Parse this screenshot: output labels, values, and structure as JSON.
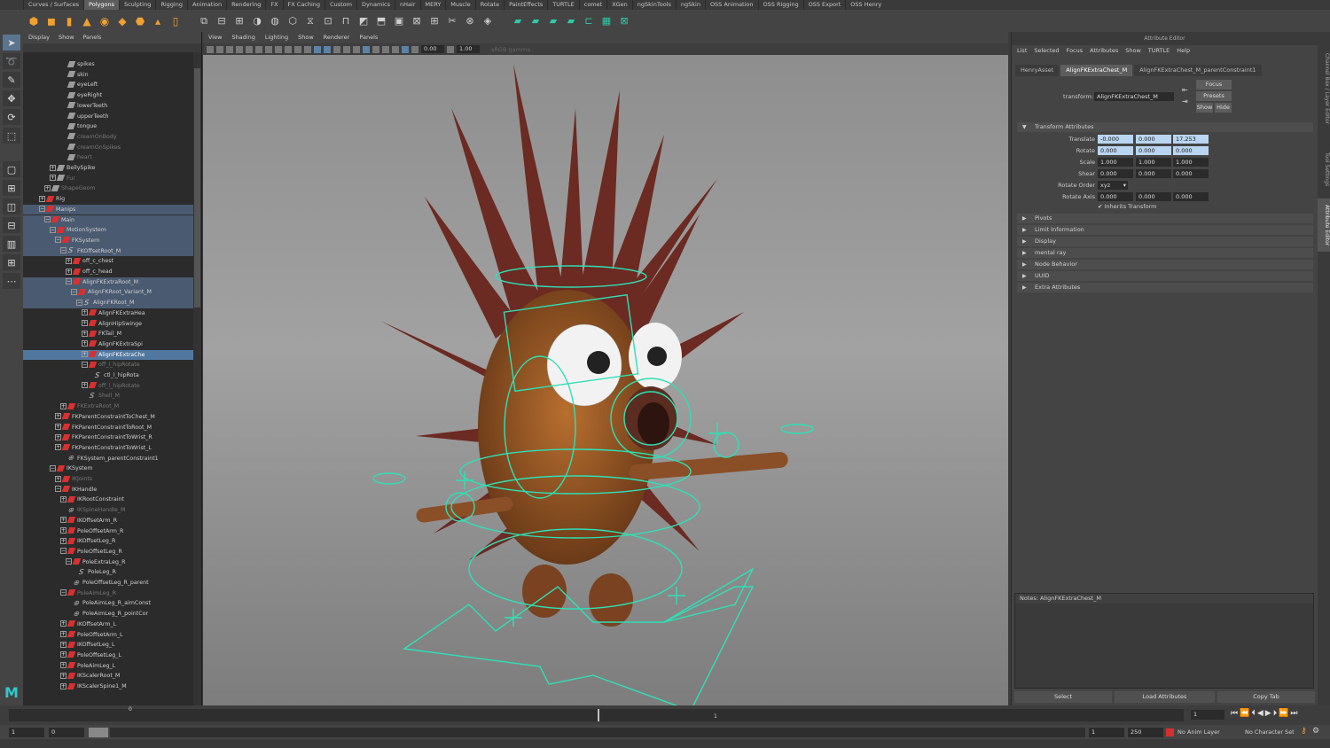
{
  "shelf_tabs": [
    "Curves / Surfaces",
    "Polygons",
    "Sculpting",
    "Rigging",
    "Animation",
    "Rendering",
    "FX",
    "FX Caching",
    "Custom",
    "Dynamics",
    "nHair",
    "MERY",
    "Muscle",
    "Rotate",
    "PaintEffects",
    "TURTLE",
    "comet",
    "XGen",
    "ngSkinTools",
    "ngSkin",
    "OSS Animation",
    "OSS Rigging",
    "OSS Export",
    "OSS Henry"
  ],
  "shelf_active": "Polygons",
  "outliner": {
    "menu": [
      "Display",
      "Show",
      "Panels"
    ],
    "rows": [
      {
        "label": "spikes",
        "indent": 7,
        "exp": "",
        "icon": "grp",
        "state": ""
      },
      {
        "label": "skin",
        "indent": 7,
        "exp": "",
        "icon": "grp",
        "state": ""
      },
      {
        "label": "eyeLeft",
        "indent": 7,
        "exp": "",
        "icon": "grp",
        "state": ""
      },
      {
        "label": "eyeRight",
        "indent": 7,
        "exp": "",
        "icon": "grp",
        "state": ""
      },
      {
        "label": "lowerTeeth",
        "indent": 7,
        "exp": "",
        "icon": "grp",
        "state": ""
      },
      {
        "label": "upperTeeth",
        "indent": 7,
        "exp": "",
        "icon": "grp",
        "state": ""
      },
      {
        "label": "tongue",
        "indent": 7,
        "exp": "",
        "icon": "grp",
        "state": ""
      },
      {
        "label": "creamOnBody",
        "indent": 7,
        "exp": "",
        "icon": "grp",
        "state": "dim"
      },
      {
        "label": "creamOnSpikes",
        "indent": 7,
        "exp": "",
        "icon": "grp",
        "state": "dim"
      },
      {
        "label": "heart",
        "indent": 7,
        "exp": "",
        "icon": "grp",
        "state": "dim"
      },
      {
        "label": "BellySpike",
        "indent": 5,
        "exp": "+",
        "icon": "grp",
        "state": ""
      },
      {
        "label": "Fur",
        "indent": 5,
        "exp": "+",
        "icon": "grp",
        "state": "dim"
      },
      {
        "label": "ShapeGeom",
        "indent": 4,
        "exp": "+",
        "icon": "grp",
        "state": "dim"
      },
      {
        "label": "Rig",
        "indent": 3,
        "exp": "+",
        "icon": "ctl",
        "state": ""
      },
      {
        "label": "Manips",
        "indent": 3,
        "exp": "−",
        "icon": "ctl",
        "state": "sel"
      },
      {
        "label": "Main",
        "indent": 4,
        "exp": "−",
        "icon": "img",
        "state": "sel"
      },
      {
        "label": "MotionSystem",
        "indent": 5,
        "exp": "−",
        "icon": "ctl",
        "state": "sel"
      },
      {
        "label": "FKSystem",
        "indent": 6,
        "exp": "−",
        "icon": "ctl",
        "state": "sel"
      },
      {
        "label": "FKOffsetRoot_M",
        "indent": 7,
        "exp": "−",
        "icon": "cv",
        "state": "sel"
      },
      {
        "label": "off_c_chest",
        "indent": 8,
        "exp": "+",
        "icon": "ctl",
        "state": ""
      },
      {
        "label": "off_c_head",
        "indent": 8,
        "exp": "+",
        "icon": "ctl",
        "state": ""
      },
      {
        "label": "AlignFKExtraRoot_M",
        "indent": 8,
        "exp": "−",
        "icon": "ctl",
        "state": "sel"
      },
      {
        "label": "AlignFKRoot_Variant_M",
        "indent": 9,
        "exp": "−",
        "icon": "ctl",
        "state": "sel"
      },
      {
        "label": "AlignFKRoot_M",
        "indent": 10,
        "exp": "−",
        "icon": "cv",
        "state": "sel"
      },
      {
        "label": "AlignFKExtraHea",
        "indent": 11,
        "exp": "+",
        "icon": "ctl",
        "state": ""
      },
      {
        "label": "AlignHipSwinge",
        "indent": 11,
        "exp": "+",
        "icon": "ctl",
        "state": ""
      },
      {
        "label": "FKTail_M",
        "indent": 11,
        "exp": "+",
        "icon": "ctl",
        "state": ""
      },
      {
        "label": "AlignFKExtraSpi",
        "indent": 11,
        "exp": "+",
        "icon": "ctl",
        "state": ""
      },
      {
        "label": "AlignFKExtraChe",
        "indent": 11,
        "exp": "+",
        "icon": "ctl",
        "state": "hi"
      },
      {
        "label": "off_l_hipRotate",
        "indent": 11,
        "exp": "−",
        "icon": "ctl",
        "state": "dim"
      },
      {
        "label": "ctl_l_hipRota",
        "indent": 12,
        "exp": "",
        "icon": "cv",
        "state": ""
      },
      {
        "label": "off_l_hipRotate",
        "indent": 11,
        "exp": "+",
        "icon": "ctl",
        "state": "dim"
      },
      {
        "label": "Shell_M",
        "indent": 11,
        "exp": "",
        "icon": "cv",
        "state": "dim"
      },
      {
        "label": "FKExtraRoot_M",
        "indent": 7,
        "exp": "+",
        "icon": "ctl",
        "state": "dim"
      },
      {
        "label": "FKParentConstraintToChest_M",
        "indent": 6,
        "exp": "+",
        "icon": "ctl",
        "state": ""
      },
      {
        "label": "FKParentConstraintToRoot_M",
        "indent": 6,
        "exp": "+",
        "icon": "ctl",
        "state": ""
      },
      {
        "label": "FKParentConstraintToWrist_R",
        "indent": 6,
        "exp": "+",
        "icon": "ctl",
        "state": ""
      },
      {
        "label": "FKParentConstraintToWrist_L",
        "indent": 6,
        "exp": "+",
        "icon": "ctl",
        "state": ""
      },
      {
        "label": "FKSystem_parentConstraint1",
        "indent": 7,
        "exp": "",
        "icon": "loc",
        "state": ""
      },
      {
        "label": "IKSystem",
        "indent": 5,
        "exp": "−",
        "icon": "ctl",
        "state": ""
      },
      {
        "label": "IKJoints",
        "indent": 6,
        "exp": "+",
        "icon": "ctl",
        "state": "dim"
      },
      {
        "label": "IKHandle",
        "indent": 6,
        "exp": "−",
        "icon": "ctl",
        "state": ""
      },
      {
        "label": "IKRootConstraint",
        "indent": 7,
        "exp": "+",
        "icon": "ctl",
        "state": ""
      },
      {
        "label": "IKSpineHandle_M",
        "indent": 7,
        "exp": "",
        "icon": "loc",
        "state": "dim"
      },
      {
        "label": "IKOffsetArm_R",
        "indent": 7,
        "exp": "+",
        "icon": "ctl",
        "state": ""
      },
      {
        "label": "PoleOffsetArm_R",
        "indent": 7,
        "exp": "+",
        "icon": "ctl",
        "state": ""
      },
      {
        "label": "IKOffsetLeg_R",
        "indent": 7,
        "exp": "+",
        "icon": "ctl",
        "state": ""
      },
      {
        "label": "PoleOffsetLeg_R",
        "indent": 7,
        "exp": "−",
        "icon": "ctl",
        "state": ""
      },
      {
        "label": "PoleExtraLeg_R",
        "indent": 8,
        "exp": "−",
        "icon": "ctl",
        "state": ""
      },
      {
        "label": "PoleLeg_R",
        "indent": 9,
        "exp": "",
        "icon": "cv",
        "state": ""
      },
      {
        "label": "PoleOffsetLeg_R_parent",
        "indent": 8,
        "exp": "",
        "icon": "loc",
        "state": ""
      },
      {
        "label": "PoleAimLeg_R",
        "indent": 7,
        "exp": "−",
        "icon": "ctl",
        "state": "dim"
      },
      {
        "label": "PoleAimLeg_R_aimConst",
        "indent": 8,
        "exp": "",
        "icon": "loc",
        "state": ""
      },
      {
        "label": "PoleAimLeg_R_pointCor",
        "indent": 8,
        "exp": "",
        "icon": "loc",
        "state": ""
      },
      {
        "label": "IKOffsetArm_L",
        "indent": 7,
        "exp": "+",
        "icon": "ctl",
        "state": ""
      },
      {
        "label": "PoleOffsetArm_L",
        "indent": 7,
        "exp": "+",
        "icon": "ctl",
        "state": ""
      },
      {
        "label": "IKOffsetLeg_L",
        "indent": 7,
        "exp": "+",
        "icon": "ctl",
        "state": ""
      },
      {
        "label": "PoleOffsetLeg_L",
        "indent": 7,
        "exp": "+",
        "icon": "ctl",
        "state": ""
      },
      {
        "label": "PoleAimLeg_L",
        "indent": 7,
        "exp": "+",
        "icon": "ctl",
        "state": ""
      },
      {
        "label": "IKScalerRoot_M",
        "indent": 7,
        "exp": "+",
        "icon": "ctl",
        "state": ""
      },
      {
        "label": "IKScalerSpine1_M",
        "indent": 7,
        "exp": "+",
        "icon": "ctl",
        "state": ""
      }
    ]
  },
  "viewport": {
    "menu": [
      "View",
      "Shading",
      "Lighting",
      "Show",
      "Renderer",
      "Panels"
    ],
    "exposure": "0.00",
    "gamma": "1.00",
    "colorspace": "sRGB gamma"
  },
  "attribute_editor": {
    "title": "Attribute Editor",
    "menu": [
      "List",
      "Selected",
      "Focus",
      "Attributes",
      "Show",
      "TURTLE",
      "Help"
    ],
    "tabs": [
      "HenryAsset",
      "AlignFKExtraChest_M",
      "AlignFKExtraChest_M_parentConstraint1"
    ],
    "transform_label": "transform:",
    "transform_value": "AlignFKExtraChest_M",
    "focus": "Focus",
    "presets": "Presets",
    "show": "Show",
    "hide": "Hide",
    "section_transform": "Transform Attributes",
    "translate_label": "Translate",
    "translate": [
      "-0.000",
      "0.000",
      "17.253"
    ],
    "rotate_label": "Rotate",
    "rotate": [
      "0.000",
      "0.000",
      "0.000"
    ],
    "scale_label": "Scale",
    "scale": [
      "1.000",
      "1.000",
      "1.000"
    ],
    "shear_label": "Shear",
    "shear": [
      "0.000",
      "0.000",
      "0.000"
    ],
    "rotate_order_label": "Rotate Order",
    "rotate_order": "xyz",
    "rotate_axis_label": "Rotate Axis",
    "rotate_axis": [
      "0.000",
      "0.000",
      "0.000"
    ],
    "inherits": "Inherits Transform",
    "sections": [
      "Pivots",
      "Limit Information",
      "Display",
      "mental ray",
      "Node Behavior",
      "UUID",
      "Extra Attributes"
    ],
    "notes_label": "Notes:  AlignFKExtraChest_M",
    "buttons": [
      "Select",
      "Load Attributes",
      "Copy Tab"
    ]
  },
  "side_tabs": [
    "Channel Box / Layer Editor",
    "Tool Settings",
    "Attribute Editor"
  ],
  "time": {
    "tick_0": "0",
    "tick_1": "1",
    "current_frame": "1",
    "range_start": "1",
    "range_start2": "0",
    "playback_start": "1",
    "playback_end": "250",
    "anim_layer": "No Anim Layer",
    "char_set": "No Character Set"
  }
}
